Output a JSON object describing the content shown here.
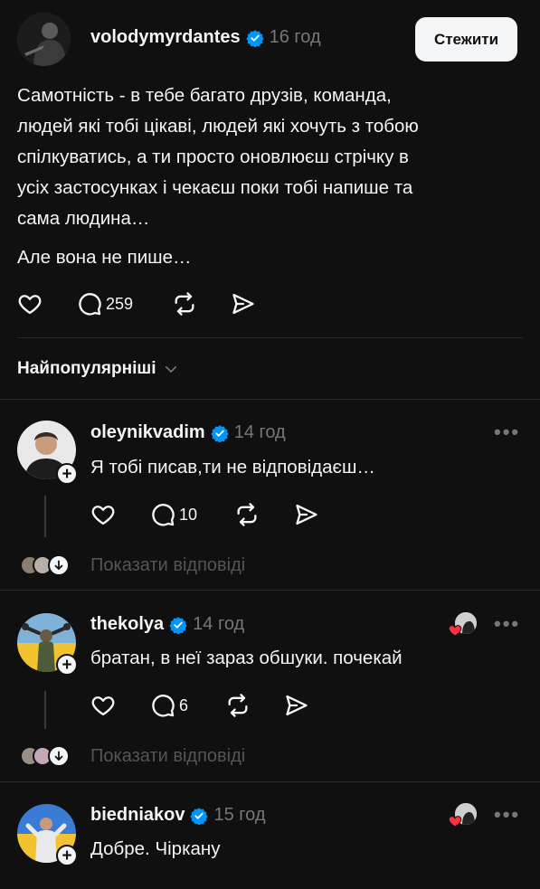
{
  "post": {
    "username": "volodymyrdantes",
    "time": "16 год",
    "follow_label": "Стежити",
    "text_lines": [
      "Самотність - в тебе багато друзів, команда,",
      "людей які тобі цікаві, людей які хочуть з тобою",
      "спілкуватись, а ти просто оновлюєш стрічку в",
      "усіх застосунках і чекаєш поки тобі напише та",
      "сама людина…"
    ],
    "text_second": "Але вона не пише…",
    "reply_count": "259",
    "icons": [
      "heart-icon",
      "comment-icon",
      "repost-icon",
      "share-icon"
    ]
  },
  "sort": {
    "label": "Найпопулярніші"
  },
  "comments": [
    {
      "username": "oleynikvadim",
      "time": "14 год",
      "text": "Я тобі писав,ти не відповідаєш…",
      "reply_count": "10",
      "show_replies": "Показати відповіді",
      "liked_by_author": false
    },
    {
      "username": "thekolya",
      "time": "14 год",
      "text": "братан, в неї зараз обшуки. почекай",
      "reply_count": "6",
      "show_replies": "Показати відповіді",
      "liked_by_author": true
    },
    {
      "username": "biedniakov",
      "time": "15 год",
      "text": "Добре. Чіркану",
      "liked_by_author": true
    }
  ],
  "colors": {
    "background": "#101010",
    "text": "#f3f5f7",
    "secondary": "#777777",
    "verified": "#0095f6",
    "like_red": "#ff3040"
  }
}
